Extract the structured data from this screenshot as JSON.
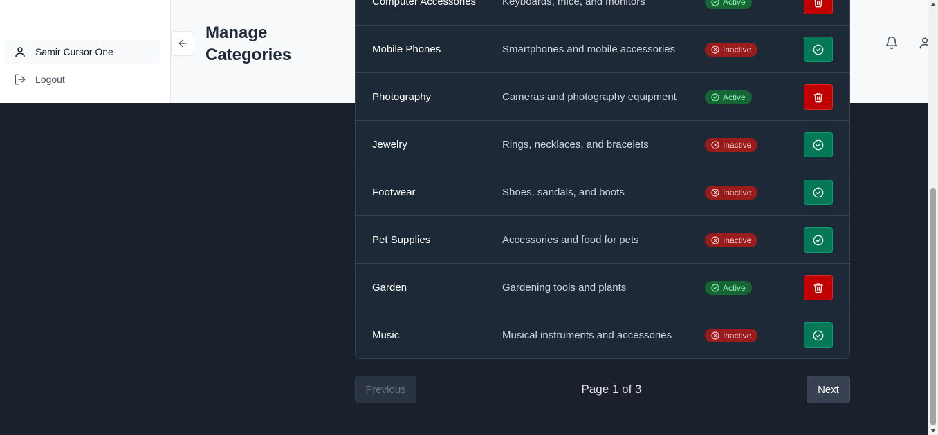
{
  "sidebar": {
    "user_name": "Samir Cursor One",
    "logout_label": "Logout"
  },
  "header": {
    "title": "Manage Categories"
  },
  "table": {
    "rows": [
      {
        "name": "Computer Accessories",
        "description": "Keyboards, mice, and monitors",
        "status": "Active"
      },
      {
        "name": "Mobile Phones",
        "description": "Smartphones and mobile accessories",
        "status": "Inactive"
      },
      {
        "name": "Photography",
        "description": "Cameras and photography equipment",
        "status": "Active"
      },
      {
        "name": "Jewelry",
        "description": "Rings, necklaces, and bracelets",
        "status": "Inactive"
      },
      {
        "name": "Footwear",
        "description": "Shoes, sandals, and boots",
        "status": "Inactive"
      },
      {
        "name": "Pet Supplies",
        "description": "Accessories and food for pets",
        "status": "Inactive"
      },
      {
        "name": "Garden",
        "description": "Gardening tools and plants",
        "status": "Active"
      },
      {
        "name": "Music",
        "description": "Musical instruments and accessories",
        "status": "Inactive"
      }
    ]
  },
  "pagination": {
    "previous_label": "Previous",
    "page_label": "Page 1 of 3",
    "next_label": "Next"
  },
  "colors": {
    "active_badge_bg": "#166534",
    "inactive_badge_bg": "#991b1b",
    "activate_button": "#047857",
    "delete_button": "#c00000",
    "background": "#1a202c"
  },
  "icons": {
    "user": "user-icon",
    "logout": "logout-icon",
    "back": "arrow-left-icon",
    "bell": "bell-icon",
    "active": "check-circle-icon",
    "inactive": "x-circle-icon",
    "delete": "trash-icon",
    "activate": "check-circle-icon"
  }
}
